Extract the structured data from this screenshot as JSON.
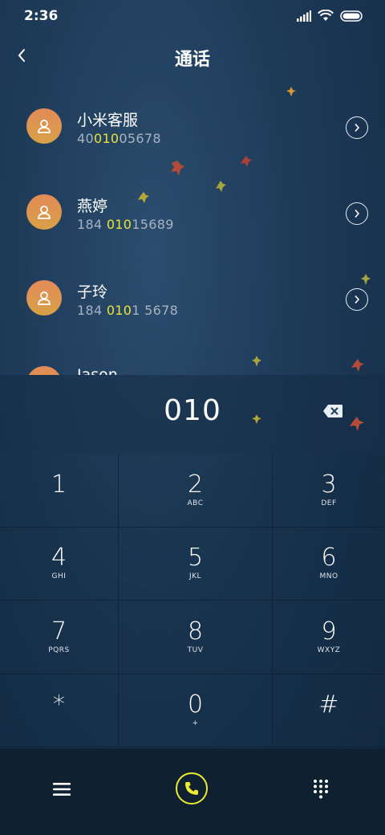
{
  "status": {
    "time": "2:36"
  },
  "header": {
    "title": "通话"
  },
  "contacts": [
    {
      "name": "小米客服",
      "num_pre": "40",
      "num_match": "010",
      "num_post": "05678"
    },
    {
      "name": "燕婷",
      "num_pre": "184 ",
      "num_match": "010",
      "num_post": "15689"
    },
    {
      "name": "子玲",
      "num_pre": "184 ",
      "num_match": "010",
      "num_post": "1 5678"
    },
    {
      "name": "Jason",
      "num_pre": "",
      "num_match": "",
      "num_post": ""
    }
  ],
  "dialer": {
    "entered": "010"
  },
  "keypad": [
    {
      "digit": "1",
      "letters": ""
    },
    {
      "digit": "2",
      "letters": "ABC"
    },
    {
      "digit": "3",
      "letters": "DEF"
    },
    {
      "digit": "4",
      "letters": "GHI"
    },
    {
      "digit": "5",
      "letters": "JKL"
    },
    {
      "digit": "6",
      "letters": "MNO"
    },
    {
      "digit": "7",
      "letters": "PQRS"
    },
    {
      "digit": "8",
      "letters": "TUV"
    },
    {
      "digit": "9",
      "letters": "WXYZ"
    },
    {
      "digit": "*",
      "letters": ""
    },
    {
      "digit": "0",
      "letters": "+"
    },
    {
      "digit": "#",
      "letters": ""
    }
  ],
  "colors": {
    "highlight": "#e9e33a",
    "call_accent": "#ecec2e",
    "avatar": "#e38a58"
  },
  "icons": {
    "back": "chevron-left-icon",
    "detail": "chevron-right-circle-icon",
    "delete": "backspace-icon",
    "menu": "menu-icon",
    "call": "phone-icon",
    "keypad": "dialpad-icon"
  }
}
